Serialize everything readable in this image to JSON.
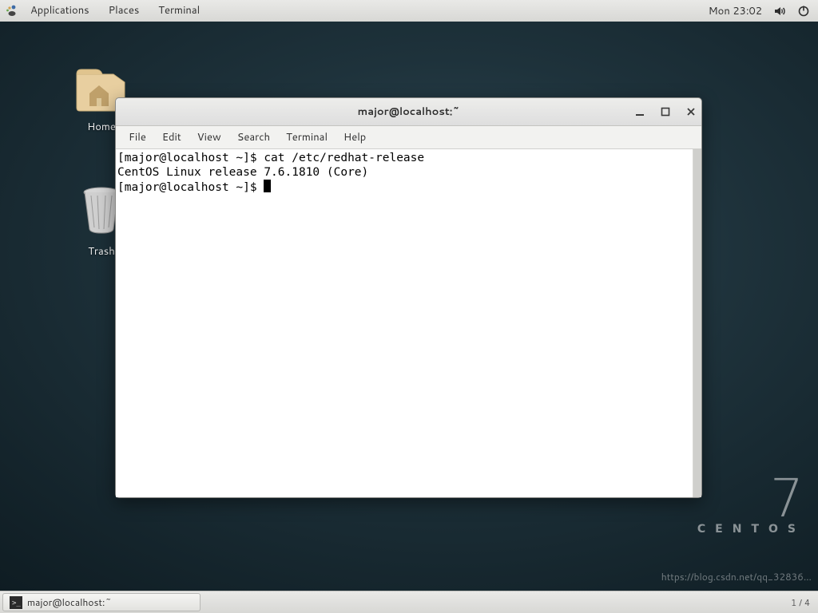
{
  "topbar": {
    "menus": [
      "Applications",
      "Places",
      "Terminal"
    ],
    "clock": "Mon 23:02"
  },
  "desktop": {
    "icons": {
      "home": "Home",
      "trash": "Trash"
    },
    "brand": {
      "version": "7",
      "name": "CENTOS"
    },
    "watermark": "https://blog.csdn.net/qq_32836…"
  },
  "terminal": {
    "title": "major@localhost:~",
    "menus": [
      "File",
      "Edit",
      "View",
      "Search",
      "Terminal",
      "Help"
    ],
    "lines": [
      "[major@localhost ~]$ cat /etc/redhat-release",
      "CentOS Linux release 7.6.1810 (Core)",
      "[major@localhost ~]$ "
    ]
  },
  "taskbar": {
    "app": "major@localhost:~",
    "workspace": "1 / 4"
  }
}
